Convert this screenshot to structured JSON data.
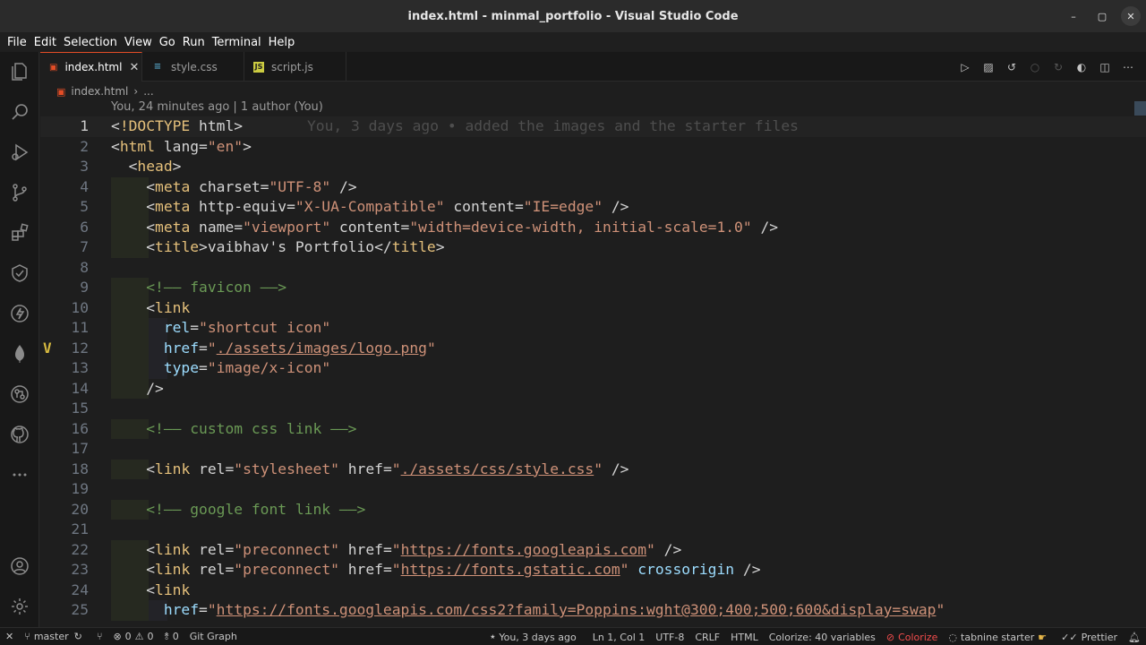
{
  "window": {
    "title": "index.html - minmal_portfolio - Visual Studio Code"
  },
  "menu": [
    "File",
    "Edit",
    "Selection",
    "View",
    "Go",
    "Run",
    "Terminal",
    "Help"
  ],
  "activity_bar": {
    "items": [
      "explorer-icon",
      "search-icon",
      "run-debug-icon",
      "source-control-icon",
      "extensions-icon",
      "testing-icon",
      "thunder-client-icon",
      "mongodb-icon",
      "git-graph-icon",
      "github-icon",
      "more-icon"
    ],
    "bottom": [
      "accounts-icon",
      "settings-gear-icon"
    ]
  },
  "tabs": [
    {
      "label": "index.html",
      "icon": "html-file-icon",
      "active": true
    },
    {
      "label": "style.css",
      "icon": "css-file-icon",
      "active": false
    },
    {
      "label": "script.js",
      "icon": "js-file-icon",
      "active": false
    }
  ],
  "breadcrumb": {
    "file": "index.html",
    "more": "..."
  },
  "codelens": "You, 24 minutes ago | 1 author (You)",
  "editor": {
    "blame": "You, 3 days ago • added the images and the starter files",
    "line_numbers": [
      "1",
      "2",
      "3",
      "4",
      "5",
      "6",
      "7",
      "8",
      "9",
      "10",
      "11",
      "12",
      "13",
      "14",
      "15",
      "16",
      "17",
      "18",
      "19",
      "20",
      "21",
      "22",
      "23",
      "24",
      "25"
    ],
    "lines": [
      "<!DOCTYPE html>",
      "<html lang=\"en\">",
      "  <head>",
      "    <meta charset=\"UTF-8\" />",
      "    <meta http-equiv=\"X-UA-Compatible\" content=\"IE=edge\" />",
      "    <meta name=\"viewport\" content=\"width=device-width, initial-scale=1.0\" />",
      "    <title>vaibhav's Portfolio</title>",
      "",
      "    <!—— favicon ——>",
      "    <link",
      "      rel=\"shortcut icon\"",
      "      href=\"./assets/images/logo.png\"",
      "      type=\"image/x-icon\"",
      "    />",
      "",
      "    <!—— custom css link ——>",
      "",
      "    <link rel=\"stylesheet\" href=\"./assets/css/style.css\" />",
      "",
      "    <!—— google font link ——>",
      "",
      "    <link rel=\"preconnect\" href=\"https://fonts.googleapis.com\" />",
      "    <link rel=\"preconnect\" href=\"https://fonts.gstatic.com\" crossorigin />",
      "    <link",
      "      href=\"https://fonts.googleapis.com/css2?family=Poppins:wght@300;400;500;600&display=swap\""
    ],
    "git_modified_line": "12"
  },
  "statusbar": {
    "branch": "master",
    "errors": "0",
    "warnings": "0",
    "ports": "0",
    "git_graph": "Git Graph",
    "blame": "You, 3 days ago",
    "cursor": "Ln 1, Col 1",
    "encoding": "UTF-8",
    "eol": "CRLF",
    "language": "HTML",
    "colorize_vars": "Colorize: 40 variables",
    "colorize": "Colorize",
    "tabnine": "tabnine starter",
    "prettier": "Prettier"
  }
}
